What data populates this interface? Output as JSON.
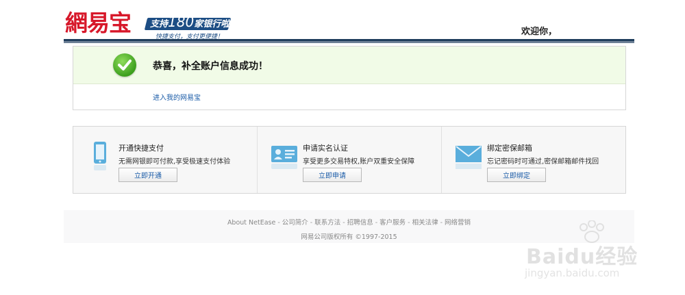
{
  "header": {
    "logo_text": "網易宝",
    "promo_prefix": "支持",
    "promo_number": "180",
    "promo_suffix": "家银行啦!",
    "promo_sub": "快捷支付，支付更便捷！",
    "welcome": "欢迎你，"
  },
  "success": {
    "title": "恭喜，补全账户信息成功！",
    "link": "进入我的网易宝",
    "icon": "checkmark-icon"
  },
  "services": [
    {
      "title": "开通快捷支付",
      "desc": "无需网银即可付款,享受极速支付体验",
      "button": "立即开通",
      "icon": "phone-icon"
    },
    {
      "title": "申请实名认证",
      "desc": "享受更多交易特权,账户双重安全保障",
      "button": "立即申请",
      "icon": "id-card-icon"
    },
    {
      "title": "绑定密保邮箱",
      "desc": "忘记密码时可通过,密保邮箱邮件找回",
      "button": "立即绑定",
      "icon": "envelope-icon"
    }
  ],
  "footer": {
    "links": [
      "About NetEase",
      "公司简介",
      "联系方法",
      "招聘信息",
      "客户服务",
      "相关法律",
      "网络营销"
    ],
    "copyright": "网易公司版权所有 ©1997-2015"
  },
  "watermark": {
    "brand": "Baidu经验",
    "url": "jingyan.baidu.com"
  },
  "colors": {
    "brand_red": "#d7182a",
    "brand_blue": "#1c4d84",
    "success_bg": "#f1fbe7",
    "link_blue": "#1b5ca8"
  }
}
